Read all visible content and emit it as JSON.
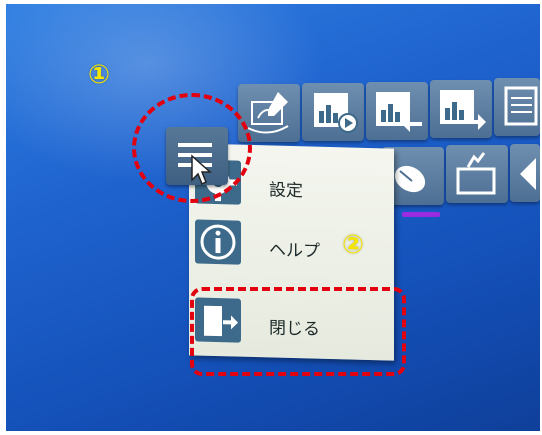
{
  "menu": {
    "items": [
      {
        "label": "設定",
        "icon": "gear-icon"
      },
      {
        "label": "ヘルプ",
        "icon": "info-icon"
      },
      {
        "label": "閉じる",
        "icon": "exit-door-icon"
      }
    ]
  },
  "annotations": {
    "step1": "①",
    "step2": "②"
  },
  "colors": {
    "annotation_red": "#e3000f",
    "annotation_yellow": "#f5e600",
    "screen_blue": "#1f63cf",
    "tile": "#5a7ea3",
    "menu_icon": "#3d6a8a"
  }
}
